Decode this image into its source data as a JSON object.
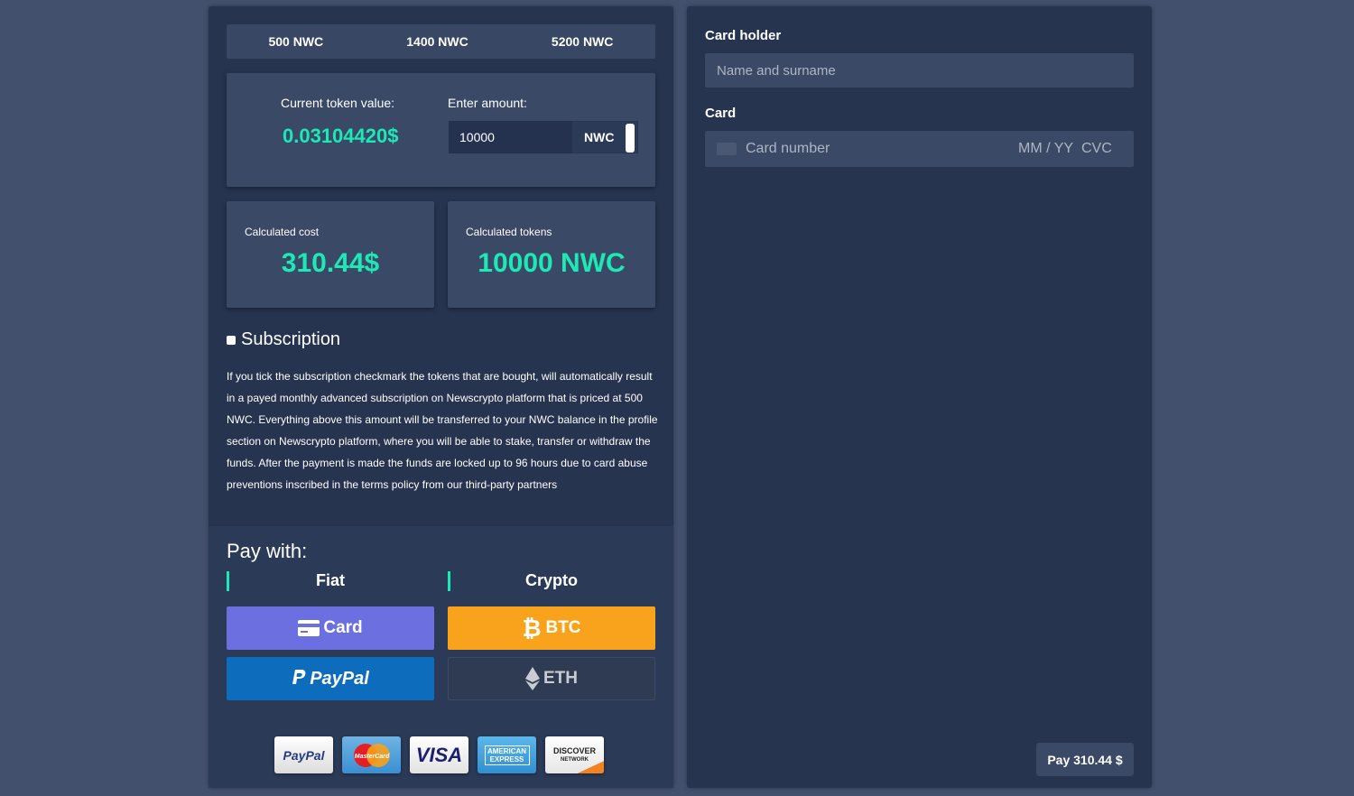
{
  "presets": [
    "500 NWC",
    "1400 NWC",
    "5200 NWC"
  ],
  "token": {
    "current_label": "Current token value:",
    "current_value": "0.03104420$",
    "amount_label": "Enter amount:",
    "amount_value": "10000",
    "unit": "NWC"
  },
  "calc": {
    "cost_label": "Calculated cost",
    "cost_value": "310.44$",
    "tokens_label": "Calculated tokens",
    "tokens_value": "10000 NWC"
  },
  "subscription": {
    "title": "Subscription",
    "checked": false,
    "text": "If you tick the subscription checkmark the tokens that are bought, will automatically result in a payed monthly advanced subscription on Newscrypto platform that is priced at 500 NWC. Everything above this amount will be transferred to your NWC balance in the profile section on Newscrypto platform, where you will be able to stake, transfer or withdraw the funds. After the payment is made the funds are locked up to 96 hours due to card abuse preventions inscribed in the terms policy from our third-party partners"
  },
  "pay_with": {
    "title": "Pay with:",
    "fiat_label": "Fiat",
    "crypto_label": "Crypto",
    "card_label": "Card",
    "btc_label": "BTC",
    "paypal_label": "PayPal",
    "eth_label": "ETH"
  },
  "logos": {
    "paypal": "PayPal",
    "mastercard": "MasterCard",
    "visa": "VISA",
    "amex": "AMERICAN EXPRESS",
    "discover": "DISCOVER",
    "discover_sub": "NETWORK"
  },
  "card_form": {
    "holder_label": "Card holder",
    "holder_placeholder": "Name and surname",
    "card_label": "Card",
    "card_number_placeholder": "Card number",
    "expiry_placeholder": "MM / YY",
    "cvc_placeholder": "CVC",
    "pay_button": "Pay 310.44 $"
  },
  "colors": {
    "accent": "#1de9b6",
    "card_button": "#6c6fe0",
    "btc_button": "#f9a31c",
    "paypal_button": "#0d6dbc"
  }
}
